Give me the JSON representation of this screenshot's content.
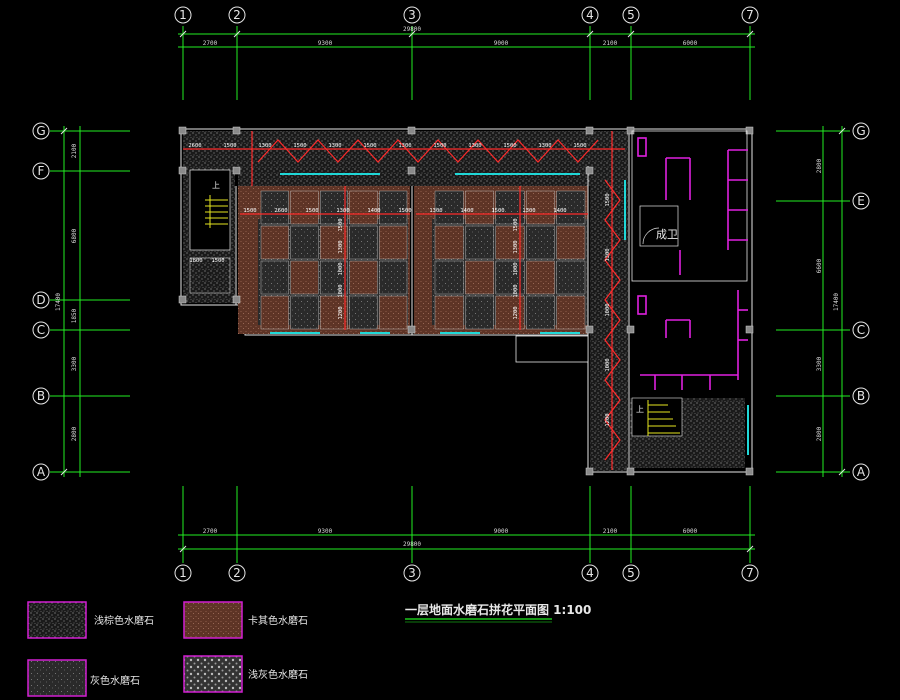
{
  "grid_axes": {
    "top_labels": [
      "1",
      "2",
      "3",
      "4",
      "5",
      "7"
    ],
    "bottom_labels": [
      "1",
      "2",
      "3",
      "4",
      "5",
      "7"
    ],
    "left_labels": [
      "G",
      "F",
      "D",
      "C",
      "B",
      "A"
    ],
    "right_labels": [
      "G",
      "E",
      "C",
      "B",
      "A"
    ]
  },
  "dimensions": {
    "top_segments": [
      "2700",
      "9300",
      "9000",
      "2100",
      "6000"
    ],
    "top_total": "29800",
    "bottom_segments": [
      "2700",
      "9300",
      "9000",
      "2100",
      "6000"
    ],
    "bottom_total": "29800",
    "left_segments": [
      "2100",
      "6800",
      "1850",
      "3300",
      "2800"
    ],
    "left_total": "17400",
    "right_segments": [
      "2800",
      "6600",
      "3300",
      "2800"
    ],
    "right_total": "17400"
  },
  "room_labels": {
    "restroom": "成卫",
    "stair_up_left": "上",
    "stair_up_right": "上"
  },
  "red_dims": {
    "row1": [
      "2600",
      "1500",
      "1300",
      "1500",
      "1300",
      "1500",
      "1300",
      "1500",
      "1300",
      "1500",
      "1300",
      "1500"
    ],
    "row2": [
      "1500",
      "2600",
      "1500",
      "1300",
      "1400",
      "1500",
      "1300",
      "1400",
      "1500",
      "1300",
      "1400"
    ],
    "row_misc": [
      "1800",
      "1500"
    ],
    "vertical": [
      "1500",
      "1300",
      "1000",
      "1000",
      "1200"
    ]
  },
  "drawing_title": "一层地面水磨石拼花平面图 1:100",
  "legend": [
    {
      "label": "浅棕色水磨石",
      "color": "#d21fd2"
    },
    {
      "label": "卡其色水磨石",
      "color": "#d21fd2"
    },
    {
      "label": "灰色水磨石",
      "color": "#d21fd2"
    },
    {
      "label": "浅灰色水磨石",
      "color": "#d21fd2"
    }
  ],
  "colors": {
    "grid": "#22ee22",
    "wall": "#e6e6e6",
    "red_dims": "#ff2b2b",
    "fixtures": "#e020e0",
    "glass": "#20d8d8",
    "terrazzo_brown": "#6a3b2a"
  }
}
